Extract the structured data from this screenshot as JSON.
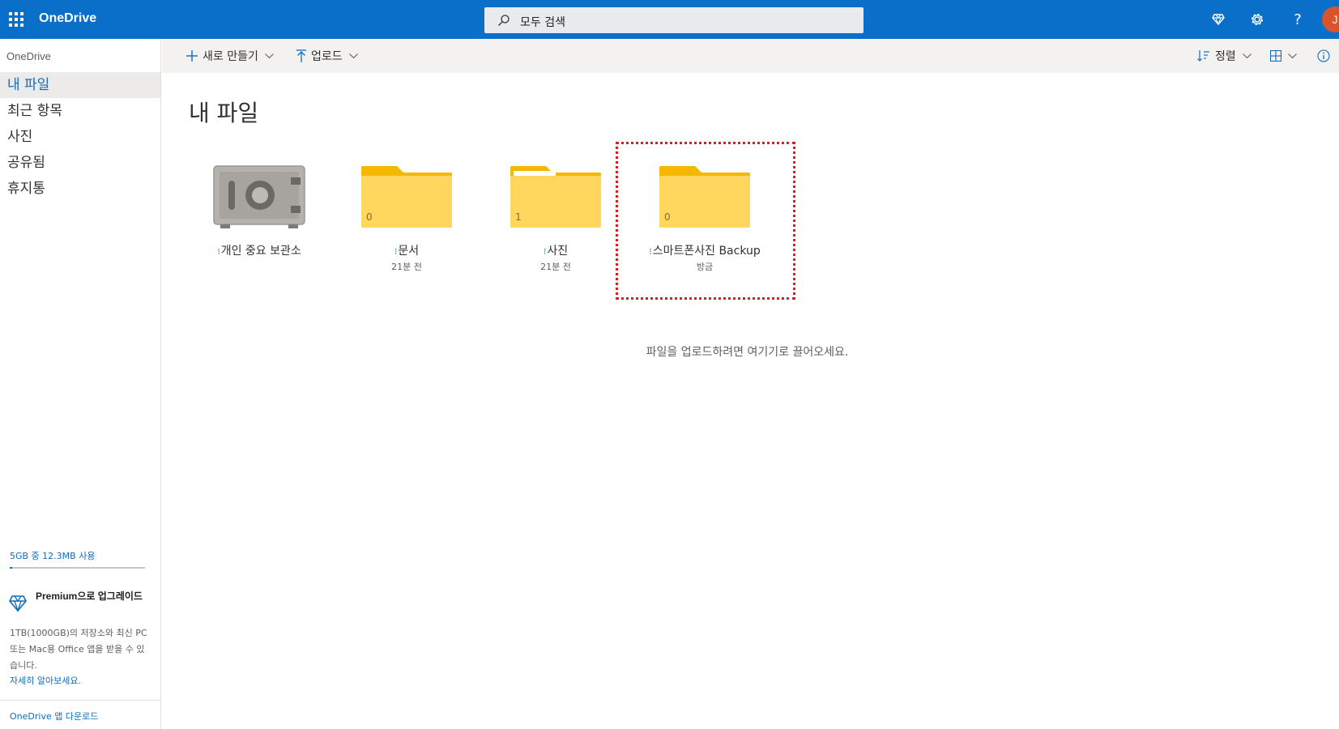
{
  "header": {
    "app_name": "OneDrive",
    "search_placeholder": "모두 검색",
    "user_initial": "J",
    "icons": [
      "waffle-icon",
      "premium-diamond-icon",
      "settings-gear-icon",
      "help-icon"
    ],
    "accent_color": "#0a6fc9"
  },
  "sidebar": {
    "title": "OneDrive",
    "items": [
      {
        "label": "내 파일",
        "active": true
      },
      {
        "label": "최근 항목",
        "active": false
      },
      {
        "label": "사진",
        "active": false
      },
      {
        "label": "공유됨",
        "active": false
      },
      {
        "label": "휴지통",
        "active": false
      }
    ],
    "storage_text": "5GB 중 12.3MB 사용",
    "storage_used_fraction": 0.0025,
    "premium_title": "Premium으로 업그레이드",
    "premium_desc": "1TB(1000GB)의 저장소와 최신 PC 또는 Mac용 Office 앱을 받을 수 있습니다.",
    "learn_more": "자세히 알아보세요.",
    "app_download": "OneDrive 앱 다운로드"
  },
  "toolbar": {
    "new_label": "새로 만들기",
    "upload_label": "업로드",
    "sort_label": "정렬"
  },
  "main": {
    "title": "내 파일",
    "items": [
      {
        "name": "개인 중요 보관소",
        "meta": "",
        "type": "vault",
        "count": ""
      },
      {
        "name": "문서",
        "meta": "21분 전",
        "type": "folder",
        "count": "0"
      },
      {
        "name": "사진",
        "meta": "21분 전",
        "type": "folder",
        "count": "1"
      },
      {
        "name": "스마트폰사진 Backup",
        "meta": "방금",
        "type": "folder",
        "count": "0",
        "highlighted": true
      }
    ],
    "drop_hint": "파일을 업로드하려면 여기기로 끌어오세요."
  }
}
